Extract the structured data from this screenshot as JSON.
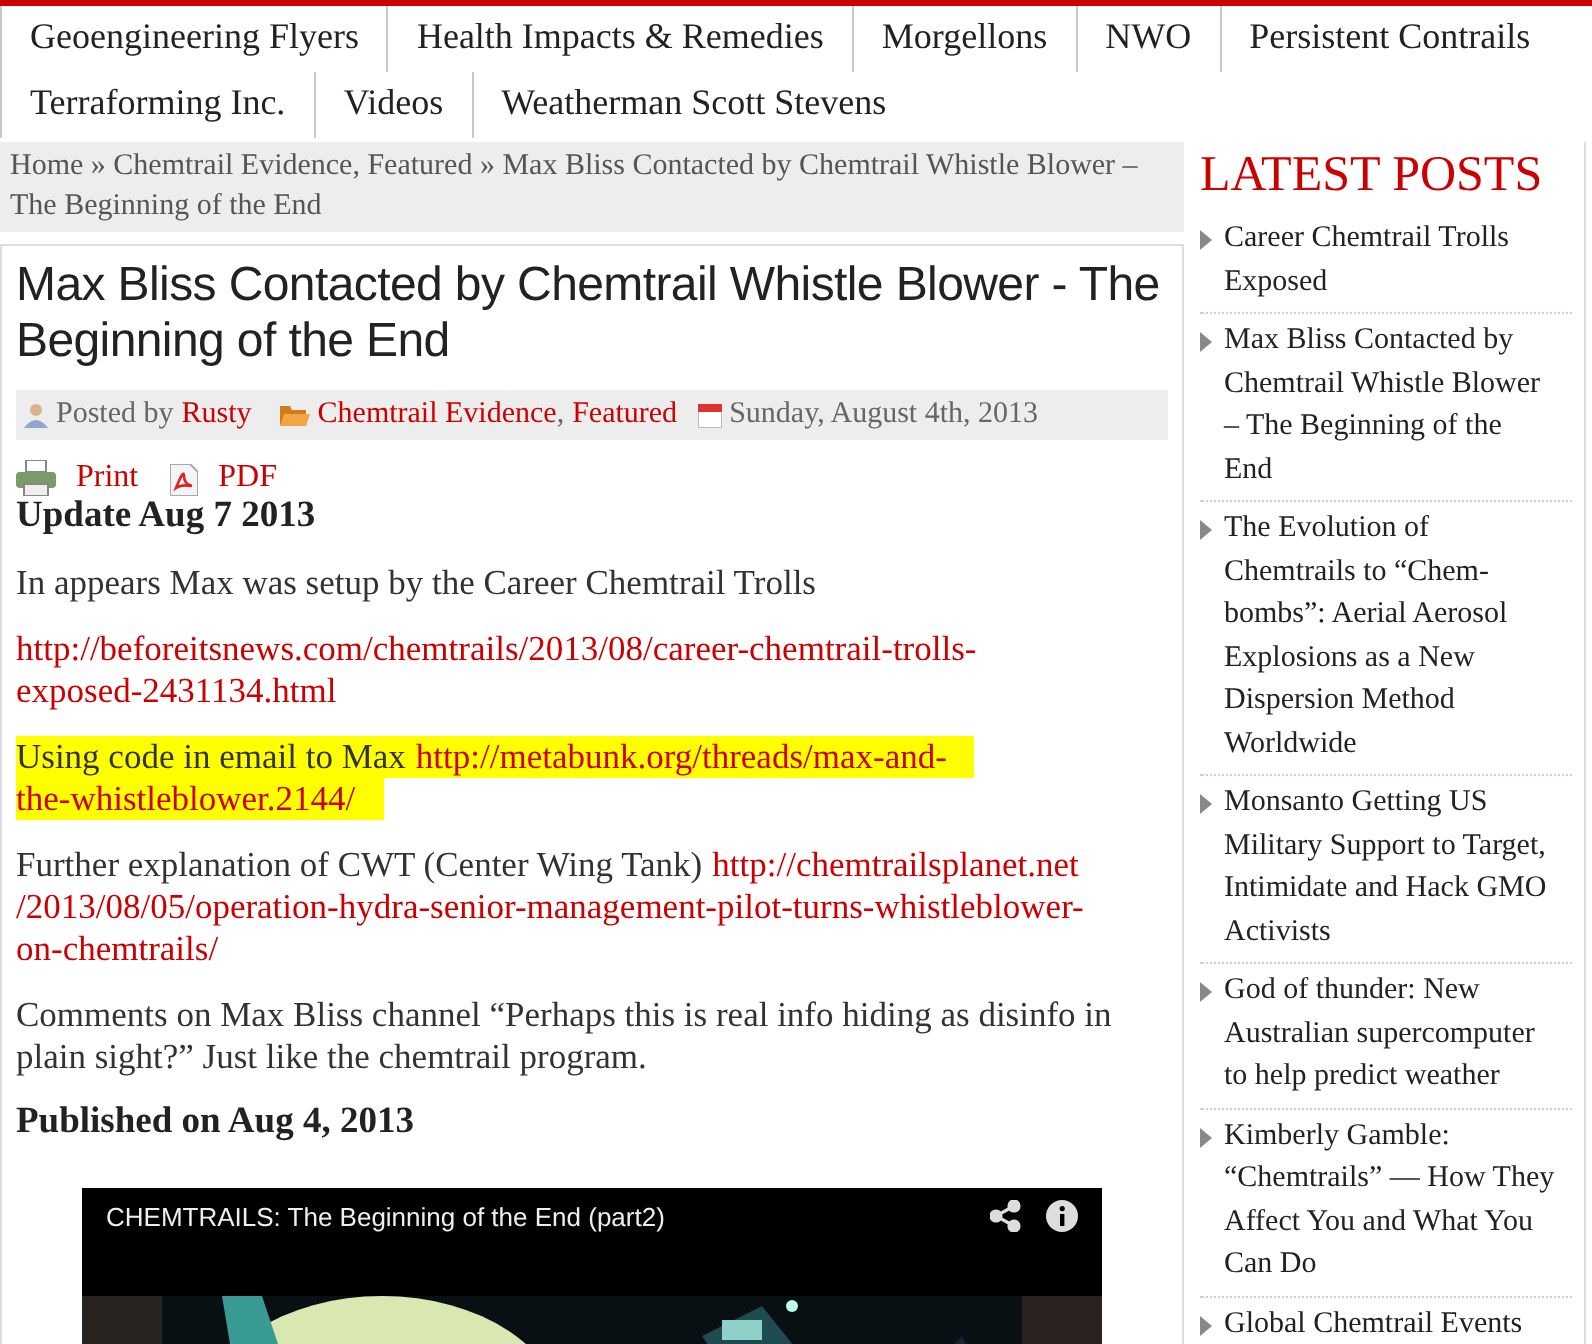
{
  "nav": [
    {
      "label": "Geoengineering Flyers"
    },
    {
      "label": "Health Impacts & Remedies"
    },
    {
      "label": "Morgellons"
    },
    {
      "label": "NWO"
    },
    {
      "label": "Persistent Contrails"
    },
    {
      "label": "Terraforming Inc."
    },
    {
      "label": "Videos"
    },
    {
      "label": "Weatherman Scott Stevens"
    }
  ],
  "breadcrumb": [
    {
      "kind": "link",
      "text": "Home"
    },
    {
      "kind": "text",
      "text": " » "
    },
    {
      "kind": "link",
      "text": "Chemtrail Evidence"
    },
    {
      "kind": "text",
      "text": ", "
    },
    {
      "kind": "link",
      "text": "Featured"
    },
    {
      "kind": "text",
      "text": " » Max Bliss Contacted by Chemtrail Whistle Blower – The Beginning of the End"
    }
  ],
  "article": {
    "title": "Max Bliss Contacted by Chemtrail Whistle Blower - The Beginning of the End",
    "meta": {
      "posted_by": "Posted by",
      "author": "Rusty",
      "categories": [
        "Chemtrail Evidence",
        "Featured"
      ],
      "separator": ",",
      "date": "Sunday, August 4th, 2013"
    },
    "actions": [
      {
        "kind": "print",
        "label": "Print"
      },
      {
        "kind": "pdf",
        "label": "PDF"
      }
    ],
    "body": [
      {
        "kind": "heading",
        "text": "Update Aug 7 2013"
      },
      {
        "kind": "para",
        "highlighted": false,
        "lines": [
          [
            {
              "kind": "text",
              "text": "In appears Max was setup by the Career Chemtrail Trolls"
            }
          ]
        ]
      },
      {
        "kind": "para",
        "highlighted": false,
        "lines": [
          [
            {
              "kind": "link",
              "text": "http://beforeitsnews.com/chemtrails/2013/08/career-chemtrail-trolls-"
            }
          ],
          [
            {
              "kind": "link",
              "text": "exposed-2431134.html"
            }
          ]
        ]
      },
      {
        "kind": "para",
        "highlighted": true,
        "lines": [
          [
            {
              "kind": "text",
              "text": "Using code in email to Max"
            },
            {
              "kind": "link",
              "text": "http://metabunk.org/threads/max-and-"
            }
          ],
          [
            {
              "kind": "link",
              "text": "the-whistleblower.2144/"
            }
          ]
        ]
      },
      {
        "kind": "para",
        "highlighted": false,
        "lines": [
          [
            {
              "kind": "text",
              "text": "Further explanation of CWT (Center Wing Tank)"
            },
            {
              "kind": "link",
              "text": "http://chemtrailsplanet.net"
            }
          ],
          [
            {
              "kind": "link",
              "text": "/2013/08/05/operation-hydra-senior-management-pilot-turns-whistleblower-"
            }
          ],
          [
            {
              "kind": "link",
              "text": "on-chemtrails/"
            }
          ]
        ]
      },
      {
        "kind": "para",
        "highlighted": false,
        "lines": [
          [
            {
              "kind": "text",
              "text": "Comments on Max Bliss channel “Perhaps this is real info hiding as disinfo in plain sight?” Just like the chemtrail program."
            }
          ]
        ]
      },
      {
        "kind": "heading",
        "text": "Published on Aug 4, 2013"
      }
    ],
    "video": {
      "title": "CHEMTRAILS: The Beginning of the End (part2)",
      "kind": "picture"
    }
  },
  "sidebar": {
    "title": "LATEST POSTS",
    "posts": [
      "Career Chemtrail Trolls Exposed",
      "Max Bliss Contacted by Chemtrail Whistle Blower – The Beginning of the End",
      "The Evolution of Chemtrails to “Chem-bombs”: Aerial Aerosol Explosions as a New Dispersion Method Worldwide",
      "Monsanto Getting US Military Support to Target, Intimidate and Hack GMO Activists",
      "God of thunder: New Australian supercomputer to help predict weather",
      "Kimberly Gamble: “Chemtrails” — How They Affect You and What You Can Do",
      "Global Chemtrail Events"
    ]
  }
}
